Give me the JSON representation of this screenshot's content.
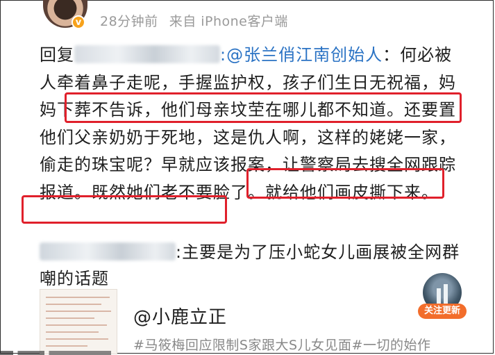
{
  "header": {
    "time": "28分钟前",
    "source": "来自 iPhone客户端",
    "verified_badge": "v"
  },
  "comment1": {
    "reply_prefix": "回复",
    "mention": ":@张兰俏江南创始人",
    "seg1": "：何必被人牵着鼻子走呢，手握监护权，孩子们生日无祝福，",
    "highlight1": "妈妈下葬不告诉，他们母亲坟茔在哪儿都不知",
    "seg2": "道。还要置他们父亲奶奶于死地，这是仇人啊，这样的姥姥一家，偷走的珠宝呢？早就应该报案，让警察局去搜全网跟踪报道。",
    "highlight2": "既然她们老不要脸了。",
    "highlight3": "就给他们画皮撕下来。"
  },
  "comment2": {
    "text": ":主要是为了压小蛇女儿画展被全网群嘲的话题"
  },
  "follow_button": {
    "label": "关注更新"
  },
  "card": {
    "title": "@小鹿立正",
    "tags": "#马筱梅回应限制S家跟大S儿女见面#一切的始作"
  },
  "colors": {
    "mention": "#2b73c4",
    "highlight_border": "#e0202b",
    "follow_button": "#f26d2b",
    "meta_text": "#9a9a9a"
  }
}
